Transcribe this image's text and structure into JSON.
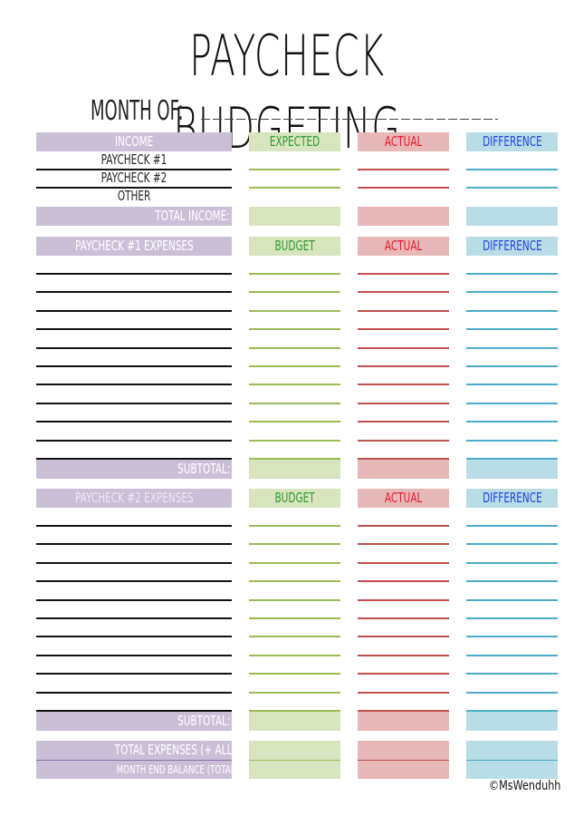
{
  "header": {
    "title": "PAYCHECK BUDGETING",
    "month_label": "MONTH OF:",
    "month_value": ""
  },
  "colors": {
    "purple": "#cbbfd8",
    "green": "#d7e4be",
    "red": "#e6b8b8",
    "blue": "#b8dde6",
    "green_text": "#2e9a2e",
    "red_text": "#e8192c",
    "blue_text": "#2243e0"
  },
  "income": {
    "header": "INCOME",
    "columns": [
      "EXPECTED",
      "ACTUAL",
      "DIFFERENCE"
    ],
    "rows": [
      "PAYCHECK #1",
      "PAYCHECK #2",
      "OTHER"
    ],
    "total_label": "TOTAL INCOME:"
  },
  "paycheck1": {
    "header": "PAYCHECK #1 EXPENSES",
    "columns": [
      "BUDGET",
      "ACTUAL",
      "DIFFERENCE"
    ],
    "line_count": 10,
    "subtotal_label": "SUBTOTAL:"
  },
  "paycheck2": {
    "header": "PAYCHECK #2 EXPENSES",
    "columns": [
      "BUDGET",
      "ACTUAL",
      "DIFFERENCE"
    ],
    "line_count": 10,
    "subtotal_label": "SUBTOTAL:"
  },
  "totals": {
    "total_expenses_label": "TOTAL EXPENSES (+ ALL SUBTOTALS):",
    "month_end_label": "MONTH END BALANCE (TOTAL INCOME - EXPENSES):"
  },
  "footer": {
    "copyright": "©MsWenduhh"
  }
}
